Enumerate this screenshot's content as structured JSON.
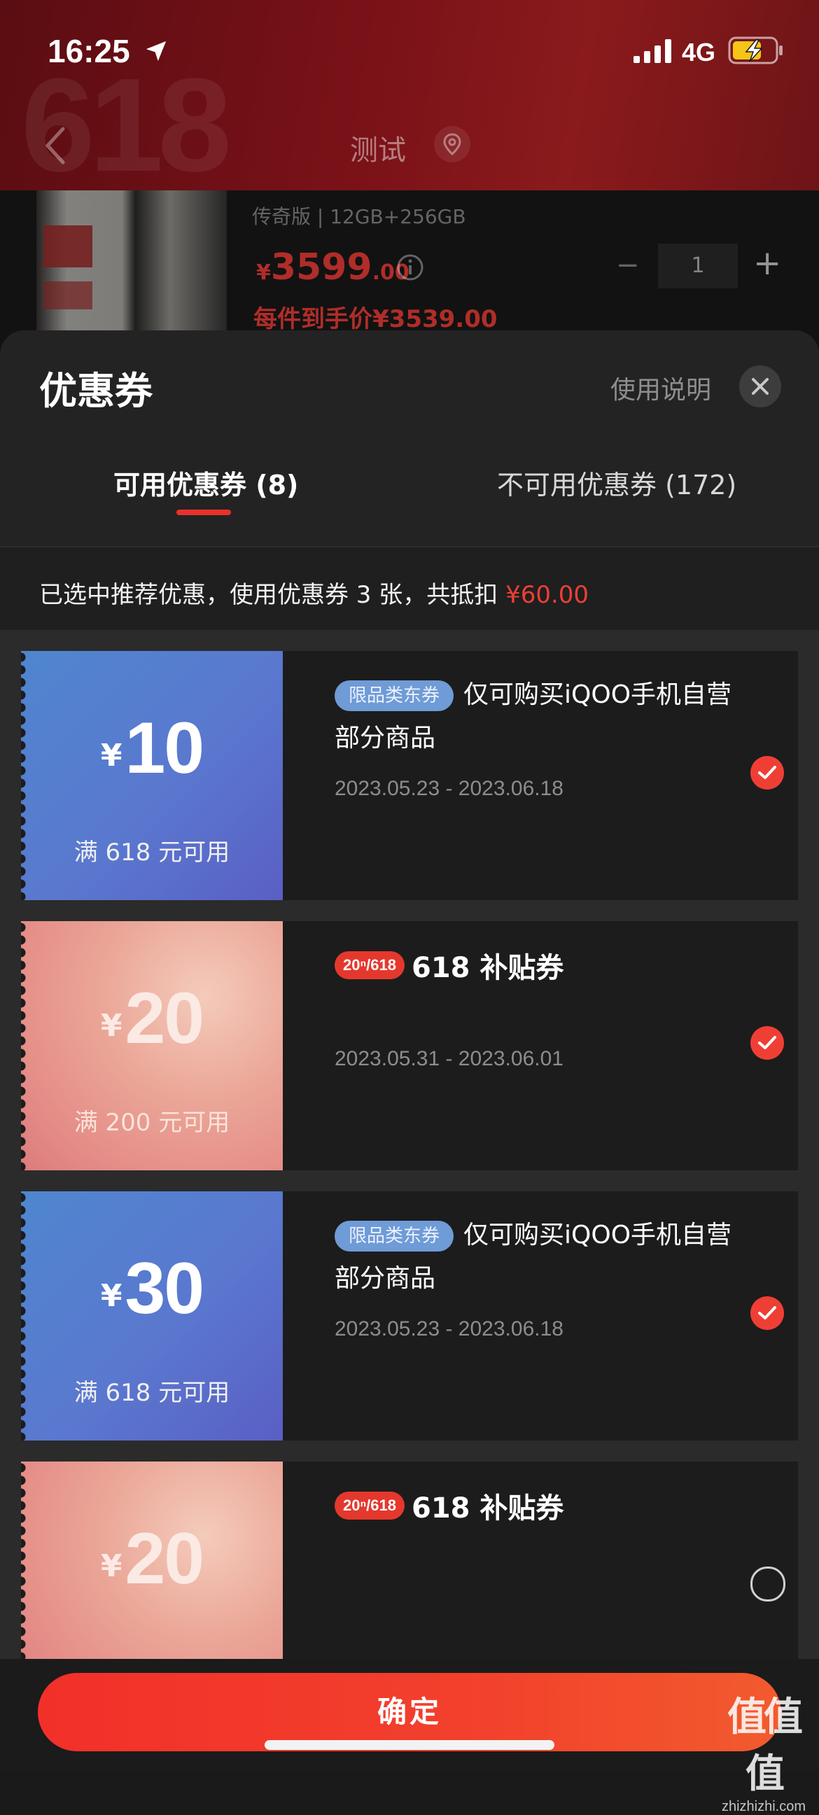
{
  "status": {
    "time": "16:25",
    "network": "4G"
  },
  "nav": {
    "title": "测试"
  },
  "product": {
    "variant": "传奇版 | 12GB+256GB",
    "price_currency": "¥",
    "price_int": "3599",
    "price_dec": ".00",
    "qty_minus": "−",
    "quantity": "1",
    "qty_plus": "+",
    "final_price": "每件到手价¥3539.00"
  },
  "sheet": {
    "title": "优惠券",
    "help_label": "使用说明",
    "tabs": [
      {
        "label": "可用优惠券 (8)",
        "active": true
      },
      {
        "label": "不可用优惠券 (172)",
        "active": false
      }
    ],
    "summary_prefix": "已选中推荐优惠，使用优惠券 3 张，共抵扣 ",
    "summary_amount": "¥60.00"
  },
  "coupons": [
    {
      "style": "blue",
      "currency": "¥",
      "amount": "10",
      "condition": "满 618 元可用",
      "tag": "限品类东券",
      "title": "仅可购买iQOO手机自营部分商品",
      "date": "2023.05.23 - 2023.06.18",
      "checked": true
    },
    {
      "style": "pink",
      "currency": "¥",
      "amount": "20",
      "condition": "满 200 元可用",
      "badge": "20ⁿ/618",
      "subsidy_title": "618 补贴券",
      "date": "2023.05.31 - 2023.06.01",
      "checked": true
    },
    {
      "style": "blue",
      "currency": "¥",
      "amount": "30",
      "condition": "满 618 元可用",
      "tag": "限品类东券",
      "title": "仅可购买iQOO手机自营部分商品",
      "date": "2023.05.23 - 2023.06.18",
      "checked": true
    },
    {
      "style": "pink",
      "currency": "¥",
      "amount": "20",
      "badge": "20ⁿ/618",
      "subsidy_title": "618 补贴券",
      "checked": false
    }
  ],
  "footer": {
    "confirm_label": "确定"
  },
  "watermark": {
    "main": "值值值",
    "sub": "zhizhizhi.com"
  },
  "colors": {
    "accent": "#ef3f35",
    "sheet_bg": "#232323",
    "blue_coupon": "#5a78cf",
    "pink_coupon": "#eba798"
  }
}
